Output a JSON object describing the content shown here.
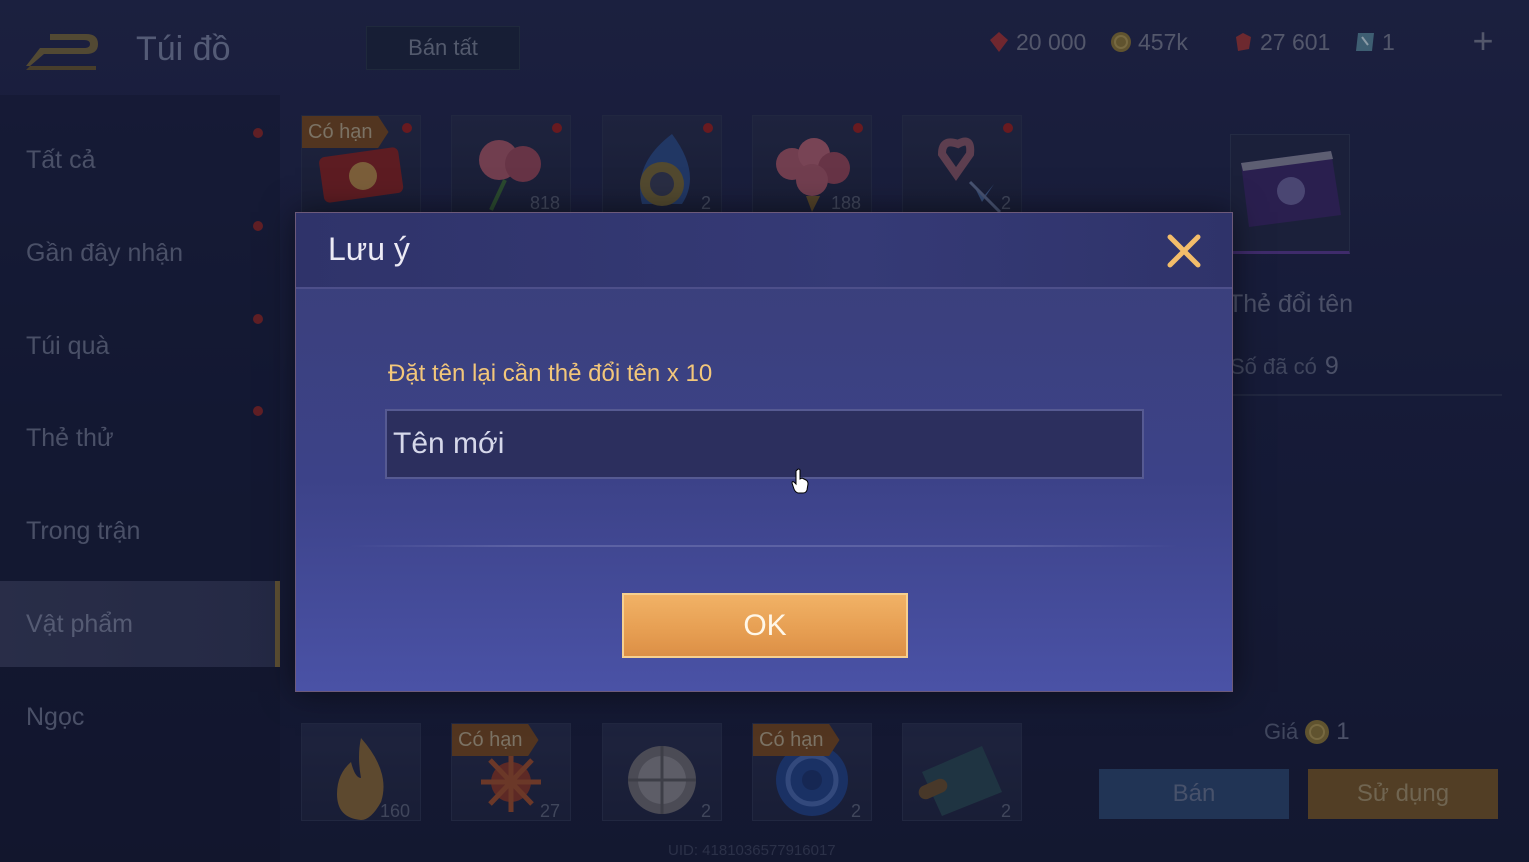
{
  "header": {
    "title": "Túi đồ",
    "sell_all_label": "Bán tất",
    "currencies": [
      {
        "icon": "red-gem-icon",
        "value": "20 000",
        "color": "#a8373a"
      },
      {
        "icon": "gold-coin-icon",
        "value": "457k",
        "color": "#8f7a3a"
      },
      {
        "icon": "ruby-icon",
        "value": "27 601",
        "color": "#a33a3a"
      },
      {
        "icon": "ticket-icon",
        "value": "1",
        "color": "#5b8aa0"
      }
    ],
    "add_label": "+"
  },
  "sidebar": {
    "items": [
      {
        "label": "Tất cả",
        "dot": true
      },
      {
        "label": "Gần đây nhận",
        "dot": true
      },
      {
        "label": "Túi quà",
        "dot": true
      },
      {
        "label": "Thẻ thử",
        "dot": true
      },
      {
        "label": "Trong trận",
        "dot": false
      },
      {
        "label": "Vật phẩm",
        "dot": false,
        "active": true
      },
      {
        "label": "Ngọc",
        "dot": false
      }
    ]
  },
  "grid": {
    "limited_tag": "Có hạn",
    "top_row": [
      {
        "name": "red-ticket-item",
        "tag": true,
        "count": ""
      },
      {
        "name": "rose-item",
        "tag": false,
        "count": "818"
      },
      {
        "name": "blue-flame-medal-item",
        "tag": false,
        "count": "2"
      },
      {
        "name": "rose-bouquet-item",
        "tag": false,
        "count": "188"
      },
      {
        "name": "heart-wand-item",
        "tag": false,
        "count": "2"
      }
    ],
    "bottom_row": [
      {
        "name": "flame-item",
        "tag": false,
        "count": "160"
      },
      {
        "name": "firework-item",
        "tag": true,
        "count": "27"
      },
      {
        "name": "orb-item",
        "tag": false,
        "count": "2"
      },
      {
        "name": "blue-swirl-item",
        "tag": true,
        "count": "2"
      },
      {
        "name": "scroll-item",
        "tag": false,
        "count": "2"
      }
    ]
  },
  "detail": {
    "item_name": "Thẻ đổi tên",
    "owned_label": "Số đã có",
    "owned_count": "9",
    "price_label": "Giá",
    "price_value": "1",
    "sell_label": "Bán",
    "use_label": "Sử dụng"
  },
  "uid_text": "UID: 4181036577916017",
  "dialog": {
    "title": "Lưu ý",
    "message": "Đặt tên lại cần thẻ đổi tên x 10",
    "input_placeholder": "Tên mới",
    "input_value": "",
    "ok_label": "OK"
  }
}
